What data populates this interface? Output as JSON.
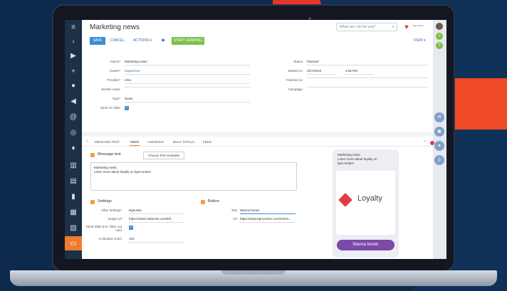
{
  "app": {
    "page_title": "Marketing news",
    "search_placeholder": "What can I do for you?",
    "account_text": "Bpm’online",
    "toolbar": {
      "save": "SAVE",
      "cancel": "CANCEL",
      "actions": "ACTIONS ▾",
      "start": "START SENDING",
      "view": "VIEW ▾"
    },
    "fields_left": [
      {
        "label": "Name*",
        "value": "Marketing news"
      },
      {
        "label": "Owner*",
        "value": "Supervisor"
      },
      {
        "label": "Provider*",
        "value": "Infra"
      },
      {
        "label": "Sender name",
        "value": ""
      },
      {
        "label": "Type*",
        "value": "News"
      },
      {
        "label": "Send To Viber",
        "value": ""
      }
    ],
    "fields_right": [
      {
        "label": "Status",
        "value": "Planned"
      },
      {
        "label": "Started on",
        "value": "3/27/2019",
        "value2": "2:55 PM"
      },
      {
        "label": "Finished on",
        "value": ""
      },
      {
        "label": "Campaign",
        "value": ""
      }
    ],
    "tabs": [
      "MESSAGE TEXT",
      "VIBER",
      "AUDIENCE",
      "BULK TOTALS",
      "FEED"
    ],
    "active_tab": "VIBER",
    "message_text": {
      "section": "Message text",
      "choose_template": "Choose from template",
      "body_line1": "Marketing news.",
      "body_line2": "Learn more about loyalty on bpm’online!"
    },
    "settings": {
      "section": "Settings",
      "rows": [
        {
          "label": "Viber settings*",
          "value": "Dgnuska"
        },
        {
          "label": "Image Url",
          "value": "https://static.btdaoxln.com/kitl..."
        },
        {
          "label": "Send SMS (For Viber not use)",
          "value": ""
        },
        {
          "label": "Is duration (min)",
          "value": "120"
        }
      ]
    },
    "button_section": {
      "section": "Button",
      "rows": [
        {
          "label": "Text",
          "value": "Wanna know!"
        },
        {
          "label": "Url",
          "value": "https://www.bpmonline.com/inform..."
        }
      ]
    },
    "preview": {
      "text_line1": "Marketing news.",
      "text_line2": "Learn more about loyalty on",
      "text_line3": "bpm’online!",
      "brand": "Loyalty",
      "button": "Wanna know!"
    },
    "colors": {
      "accent": "#f07b30",
      "primary": "#3a8ed5",
      "start_green": "#7ec04a",
      "viber_purple": "#7b49a8",
      "sidebar": "#1c3047"
    }
  },
  "icons": [
    "menu-icon",
    "chevron-right-icon",
    "play-icon",
    "plus-icon",
    "user-icon",
    "megaphone-icon",
    "at-icon",
    "target-icon",
    "pin-icon",
    "buildings-icon",
    "document-icon",
    "chart-icon",
    "calendar-icon",
    "table-icon",
    "chat-icon"
  ]
}
